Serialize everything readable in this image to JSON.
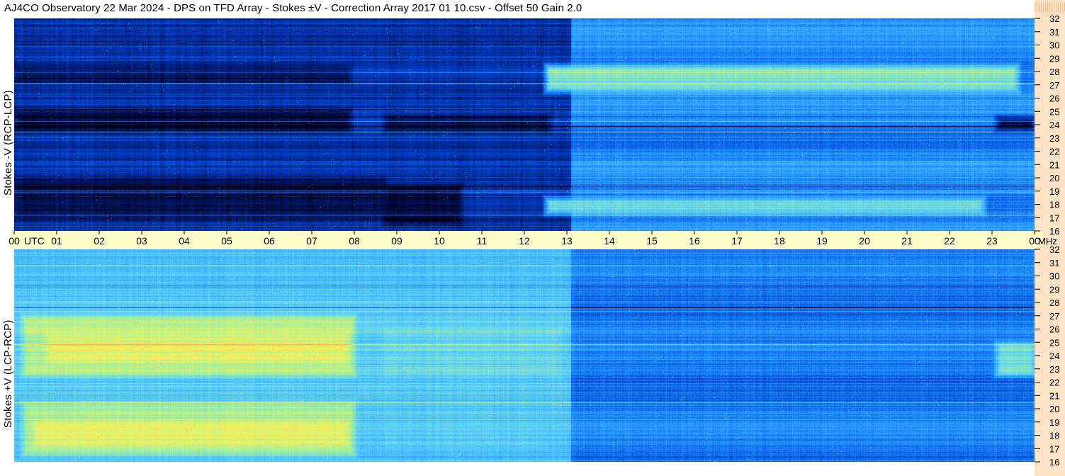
{
  "title": "AJ4CO Observatory  22 Mar 2024  -  DPS on TFD Array  -  Stokes ±V  -  Correction Array 2017 01 10.csv  -  Offset 50  Gain 2.0",
  "chart_data": [
    {
      "type": "heatmap",
      "panel": "top",
      "ylabel": "Stokes -V (RCP-LCP)",
      "x_range_utc_hours": [
        0,
        24
      ],
      "y_range_mhz": [
        16,
        32
      ],
      "colormap": [
        "#00001e",
        "#003cc8",
        "#1e8cff",
        "#55ccff",
        "#a0f0a0",
        "#fff050",
        "#ff8c6e"
      ],
      "dominant_level": "low",
      "bands": [
        {
          "utc_start": 0,
          "utc_end": 7.9,
          "mhz_low": 23.5,
          "mhz_high": 25.2,
          "level": 0.02
        },
        {
          "utc_start": 0,
          "utc_end": 7.9,
          "mhz_low": 27.2,
          "mhz_high": 28.5,
          "level": 0.05
        },
        {
          "utc_start": 0,
          "utc_end": 8.7,
          "mhz_low": 17.0,
          "mhz_high": 20.0,
          "level": 0.04
        },
        {
          "utc_start": 8.7,
          "utc_end": 12.6,
          "mhz_low": 23.5,
          "mhz_high": 24.8,
          "level": 0.05
        },
        {
          "utc_start": 8.7,
          "utc_end": 10.5,
          "mhz_low": 16.5,
          "mhz_high": 19.5,
          "level": 0.02
        },
        {
          "utc_start": 12.5,
          "utc_end": 23.6,
          "mhz_low": 26.5,
          "mhz_high": 28.5,
          "level": 0.6
        },
        {
          "utc_start": 12.5,
          "utc_end": 22.8,
          "mhz_low": 17.3,
          "mhz_high": 18.5,
          "level": 0.55
        },
        {
          "utc_start": 23.1,
          "utc_end": 24.0,
          "mhz_low": 23.6,
          "mhz_high": 24.6,
          "level": 0.05
        }
      ]
    },
    {
      "type": "heatmap",
      "panel": "bottom",
      "ylabel": "Stokes +V  (LCP-RCP)",
      "x_range_utc_hours": [
        0,
        24
      ],
      "y_range_mhz": [
        16,
        32
      ],
      "colormap": [
        "#00001e",
        "#003cc8",
        "#1e8cff",
        "#55ccff",
        "#a0f0a0",
        "#fff050",
        "#ff8c6e"
      ],
      "dominant_level": "high",
      "bands": [
        {
          "utc_start": 0.8,
          "utc_end": 7.8,
          "mhz_low": 23.6,
          "mhz_high": 25.5,
          "level": 0.9
        },
        {
          "utc_start": 0.5,
          "utc_end": 7.8,
          "mhz_low": 17.3,
          "mhz_high": 19.0,
          "level": 0.88
        },
        {
          "utc_start": 0.2,
          "utc_end": 8.0,
          "mhz_low": 22.5,
          "mhz_high": 27.0,
          "level": 0.7
        },
        {
          "utc_start": 0.2,
          "utc_end": 8.0,
          "mhz_low": 16.5,
          "mhz_high": 20.5,
          "level": 0.68
        },
        {
          "utc_start": 8.7,
          "utc_end": 12.8,
          "mhz_low": 22.5,
          "mhz_high": 26.0,
          "level": 0.55
        },
        {
          "utc_start": 8.7,
          "utc_end": 12.5,
          "mhz_low": 17.0,
          "mhz_high": 20.0,
          "level": 0.5
        },
        {
          "utc_start": 23.1,
          "utc_end": 24.0,
          "mhz_low": 22.5,
          "mhz_high": 25.0,
          "level": 0.58
        }
      ]
    }
  ],
  "time_axis": {
    "ticks": [
      "00",
      "01",
      "02",
      "03",
      "04",
      "05",
      "06",
      "07",
      "08",
      "09",
      "10",
      "11",
      "12",
      "13",
      "14",
      "15",
      "16",
      "17",
      "18",
      "19",
      "20",
      "21",
      "22",
      "23",
      "00"
    ],
    "utc_label": "UTC",
    "mhz_label": "MHz"
  },
  "freq_axis": {
    "ticks": [
      "32",
      "31",
      "30",
      "29",
      "28",
      "27",
      "26",
      "25",
      "24",
      "23",
      "22",
      "21",
      "20",
      "19",
      "18",
      "17",
      "16"
    ]
  }
}
